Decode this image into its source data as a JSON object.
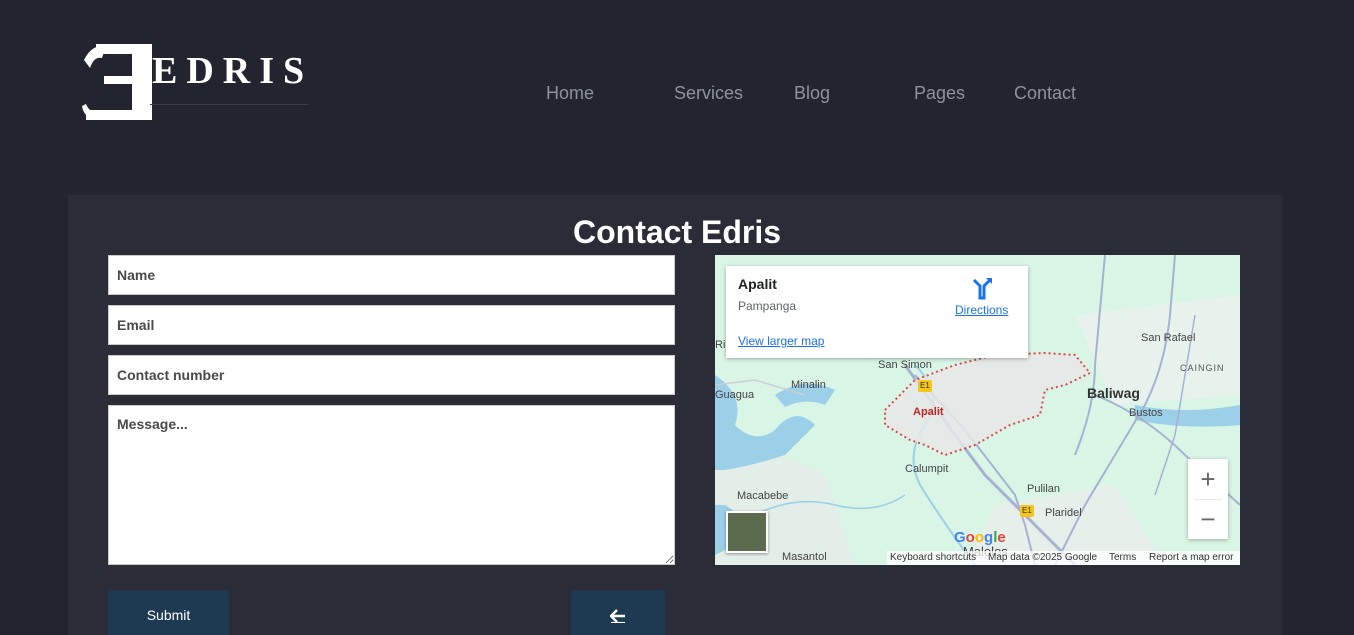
{
  "brand": {
    "name": "EDRIS"
  },
  "nav": {
    "items": [
      "Home",
      "Services",
      "Blog",
      "Pages",
      "Contact"
    ]
  },
  "contact": {
    "title": "Contact Edris",
    "name_placeholder": "Name",
    "email_placeholder": "Email",
    "phone_placeholder": "Contact number",
    "message_placeholder": "Message...",
    "submit_label": "Submit",
    "back_label": "🡐"
  },
  "map": {
    "place_name": "Apalit",
    "place_region": "Pampanga",
    "directions_label": "Directions",
    "larger_map_label": "View larger map",
    "labels": {
      "san_simon": "San Simon",
      "minalin": "Minalin",
      "guagua": "Guagua",
      "apalit": "Apalit",
      "baliwag": "Baliwag",
      "bustos": "Bustos",
      "san_rafael": "San Rafael",
      "caingin": "CAINGIN",
      "calumpit": "Calumpit",
      "macabebe": "Macabebe",
      "pulilan": "Pulilan",
      "plaridel": "Plaridel",
      "masantol": "Masantol",
      "malolos": "Malolos",
      "e1_a": "E1",
      "e1_b": "E1",
      "ri": "Ri"
    },
    "zoom_in": "+",
    "zoom_out": "−",
    "google": "Google",
    "attribution": {
      "shortcuts": "Keyboard shortcuts",
      "data": "Map data ©2025 Google",
      "terms": "Terms",
      "report": "Report a map error"
    }
  },
  "colors": {
    "background": "#22252f",
    "panel": "#2a2d38",
    "button": "#1d3a52",
    "nav_text": "#8e929b"
  }
}
